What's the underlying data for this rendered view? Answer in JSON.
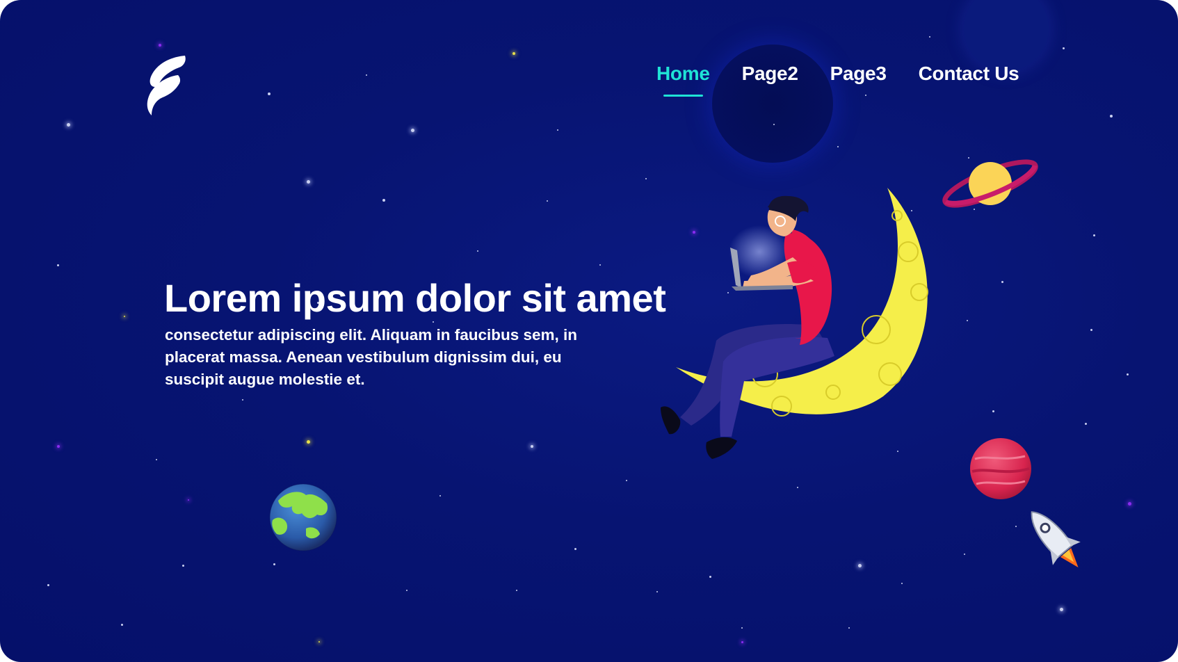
{
  "nav": {
    "items": [
      {
        "label": "Home",
        "active": true
      },
      {
        "label": "Page2",
        "active": false
      },
      {
        "label": "Page3",
        "active": false
      },
      {
        "label": "Contact Us",
        "active": false
      }
    ]
  },
  "hero": {
    "title": "Lorem ipsum dolor sit amet",
    "text": "consectetur adipiscing elit. Aliquam in faucibus sem, in placerat massa. Aenean vestibulum dignissim dui, eu suscipit augue molestie et."
  },
  "colors": {
    "background": "#071472",
    "accent": "#1fe3d6",
    "text": "#ffffff",
    "moon": "#f5ee4a",
    "shirt": "#e8174a"
  },
  "icons": {
    "logo": "brand-logo-icon",
    "earth": "earth-icon",
    "saturn": "saturn-icon",
    "mars": "red-planet-icon",
    "rocket": "rocket-icon",
    "moon": "crescent-moon-icon"
  }
}
